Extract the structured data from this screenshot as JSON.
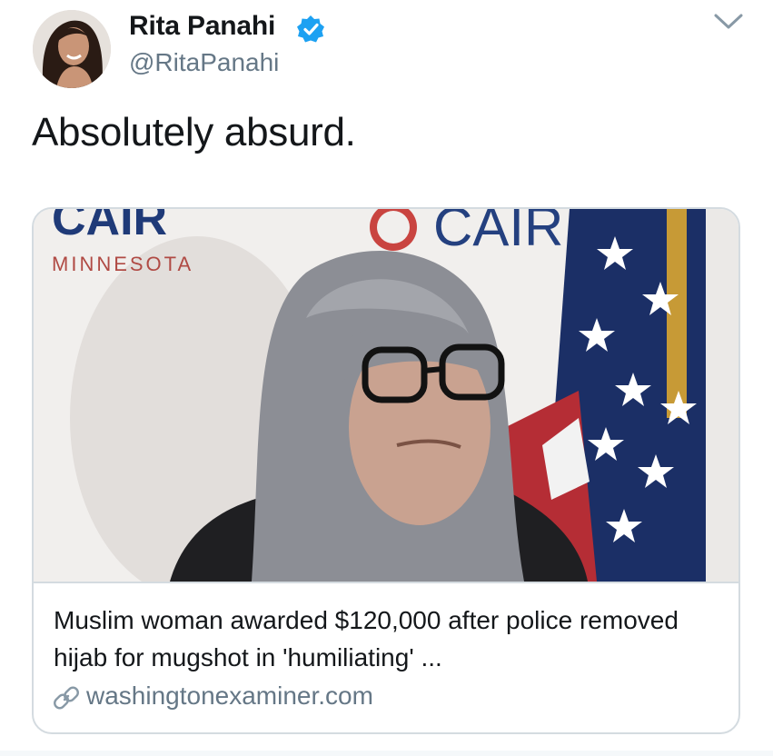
{
  "tweet": {
    "author": {
      "name": "Rita Panahi",
      "handle": "@RitaPanahi",
      "avatar_icon": "profile-photo",
      "verified": true,
      "verified_icon": "verified-badge-icon"
    },
    "menu_icon": "chevron-down-icon",
    "text": "Absolutely absurd.",
    "card": {
      "title": "Muslim woman awarded $120,000 after police removed hijab for mugshot in 'humiliating' ...",
      "domain": "washingtonexaminer.com",
      "link_icon": "link-icon",
      "image": {
        "backdrop_text_top": "CAIR",
        "backdrop_text_sub": "MINNESOTA"
      }
    }
  },
  "colors": {
    "text_primary": "#14171a",
    "text_secondary": "#657786",
    "verified_blue": "#1da1f2",
    "card_border": "#d4dbe0"
  }
}
